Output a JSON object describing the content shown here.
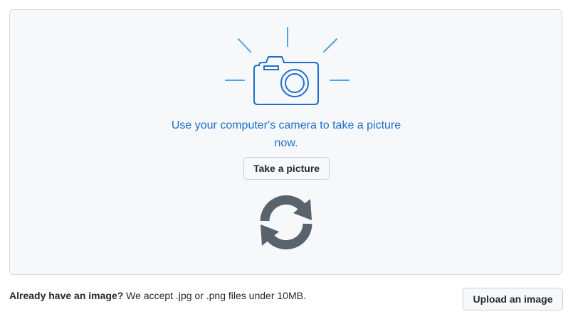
{
  "camera_section": {
    "icon": "camera-icon",
    "prompt": "Use your computer's camera to take a picture now.",
    "take_picture_label": "Take a picture",
    "refresh_icon": "refresh-icon"
  },
  "footer": {
    "lead": "Already have an image?",
    "description": " We accept .jpg or .png files under 10MB.",
    "upload_label": "Upload an image"
  },
  "colors": {
    "accent": "#1f6fcb",
    "panel_background": "#f6f8fa",
    "refresh_icon": "#59636e"
  }
}
